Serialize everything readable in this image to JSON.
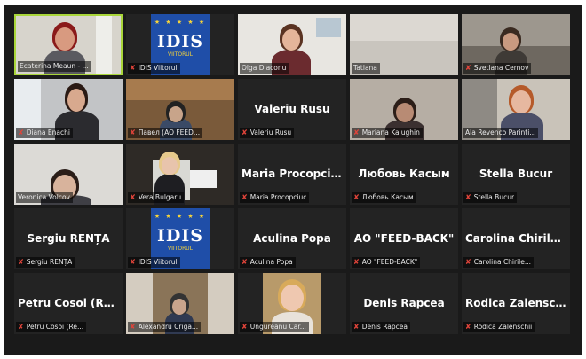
{
  "participants": [
    {
      "display_name": "",
      "label": "Ecaterina Meaun - ...",
      "muted": false,
      "active": true,
      "has_video": true
    },
    {
      "display_name": "",
      "label": "IDIS Viitorul",
      "muted": true,
      "active": false,
      "has_video": true
    },
    {
      "display_name": "",
      "label": "Olga Diaconu",
      "muted": false,
      "active": false,
      "has_video": true
    },
    {
      "display_name": "",
      "label": "Tatiana",
      "muted": false,
      "active": false,
      "has_video": true
    },
    {
      "display_name": "",
      "label": "Svetlana Cernov",
      "muted": true,
      "active": false,
      "has_video": true
    },
    {
      "display_name": "",
      "label": "Diana Enachi",
      "muted": true,
      "active": false,
      "has_video": true
    },
    {
      "display_name": "",
      "label": "Павел (AO FEED...",
      "muted": true,
      "active": false,
      "has_video": true
    },
    {
      "display_name": "Valeriu Rusu",
      "label": "Valeriu Rusu",
      "muted": true,
      "active": false,
      "has_video": false
    },
    {
      "display_name": "",
      "label": "Mariana Kalughin",
      "muted": true,
      "active": false,
      "has_video": true
    },
    {
      "display_name": "",
      "label": "Ala Revenco Parinti...",
      "muted": false,
      "active": false,
      "has_video": true
    },
    {
      "display_name": "",
      "label": "Veronica Volcov",
      "muted": false,
      "active": false,
      "has_video": true
    },
    {
      "display_name": "",
      "label": "Vera Bulgaru",
      "muted": true,
      "active": false,
      "has_video": true
    },
    {
      "display_name": "Maria Procopciuc",
      "label": "Maria Procopciuc",
      "muted": true,
      "active": false,
      "has_video": false
    },
    {
      "display_name": "Любовь Касым",
      "label": "Любовь Касым",
      "muted": true,
      "active": false,
      "has_video": false
    },
    {
      "display_name": "Stella Bucur",
      "label": "Stella Bucur",
      "muted": true,
      "active": false,
      "has_video": false
    },
    {
      "display_name": "Sergiu RENȚA",
      "label": "Sergiu RENȚA",
      "muted": true,
      "active": false,
      "has_video": false
    },
    {
      "display_name": "",
      "label": "IDIS Viitorul",
      "muted": true,
      "active": false,
      "has_video": true
    },
    {
      "display_name": "Aculina Popa",
      "label": "Aculina Popa",
      "muted": true,
      "active": false,
      "has_video": false
    },
    {
      "display_name": "AO \"FEED-BACK\"",
      "label": "AO \"FEED-BACK\"",
      "muted": true,
      "active": false,
      "has_video": false
    },
    {
      "display_name": "Carolina Chiriles...",
      "label": "Carolina Chirile...",
      "muted": true,
      "active": false,
      "has_video": false
    },
    {
      "display_name": "Petru Cosoi (Re...",
      "label": "Petru Cosoi (Re...",
      "muted": true,
      "active": false,
      "has_video": false
    },
    {
      "display_name": "",
      "label": "Alexandru Criga...",
      "muted": true,
      "active": false,
      "has_video": true
    },
    {
      "display_name": "",
      "label": "Ungureanu Car...",
      "muted": true,
      "active": false,
      "has_video": true
    },
    {
      "display_name": "Denis Rapcea",
      "label": "Denis Rapcea",
      "muted": true,
      "active": false,
      "has_video": false
    },
    {
      "display_name": "Rodica Zalenschii",
      "label": "Rodica Zalenschii",
      "muted": true,
      "active": false,
      "has_video": false
    }
  ],
  "logo": {
    "text": "IDIS",
    "subtitle": "VIITORUL",
    "stars": "★ ★ ★ ★ ★"
  },
  "colors": {
    "gallery_bg": "#1a1a1a",
    "tile_bg": "#232323",
    "active_border": "#a9d63a",
    "muted_icon": "#e0443a",
    "logo_blue": "#1f4ea8",
    "logo_yellow": "#f5d33b"
  },
  "icons": {
    "muted": "microphone-muted-icon"
  }
}
